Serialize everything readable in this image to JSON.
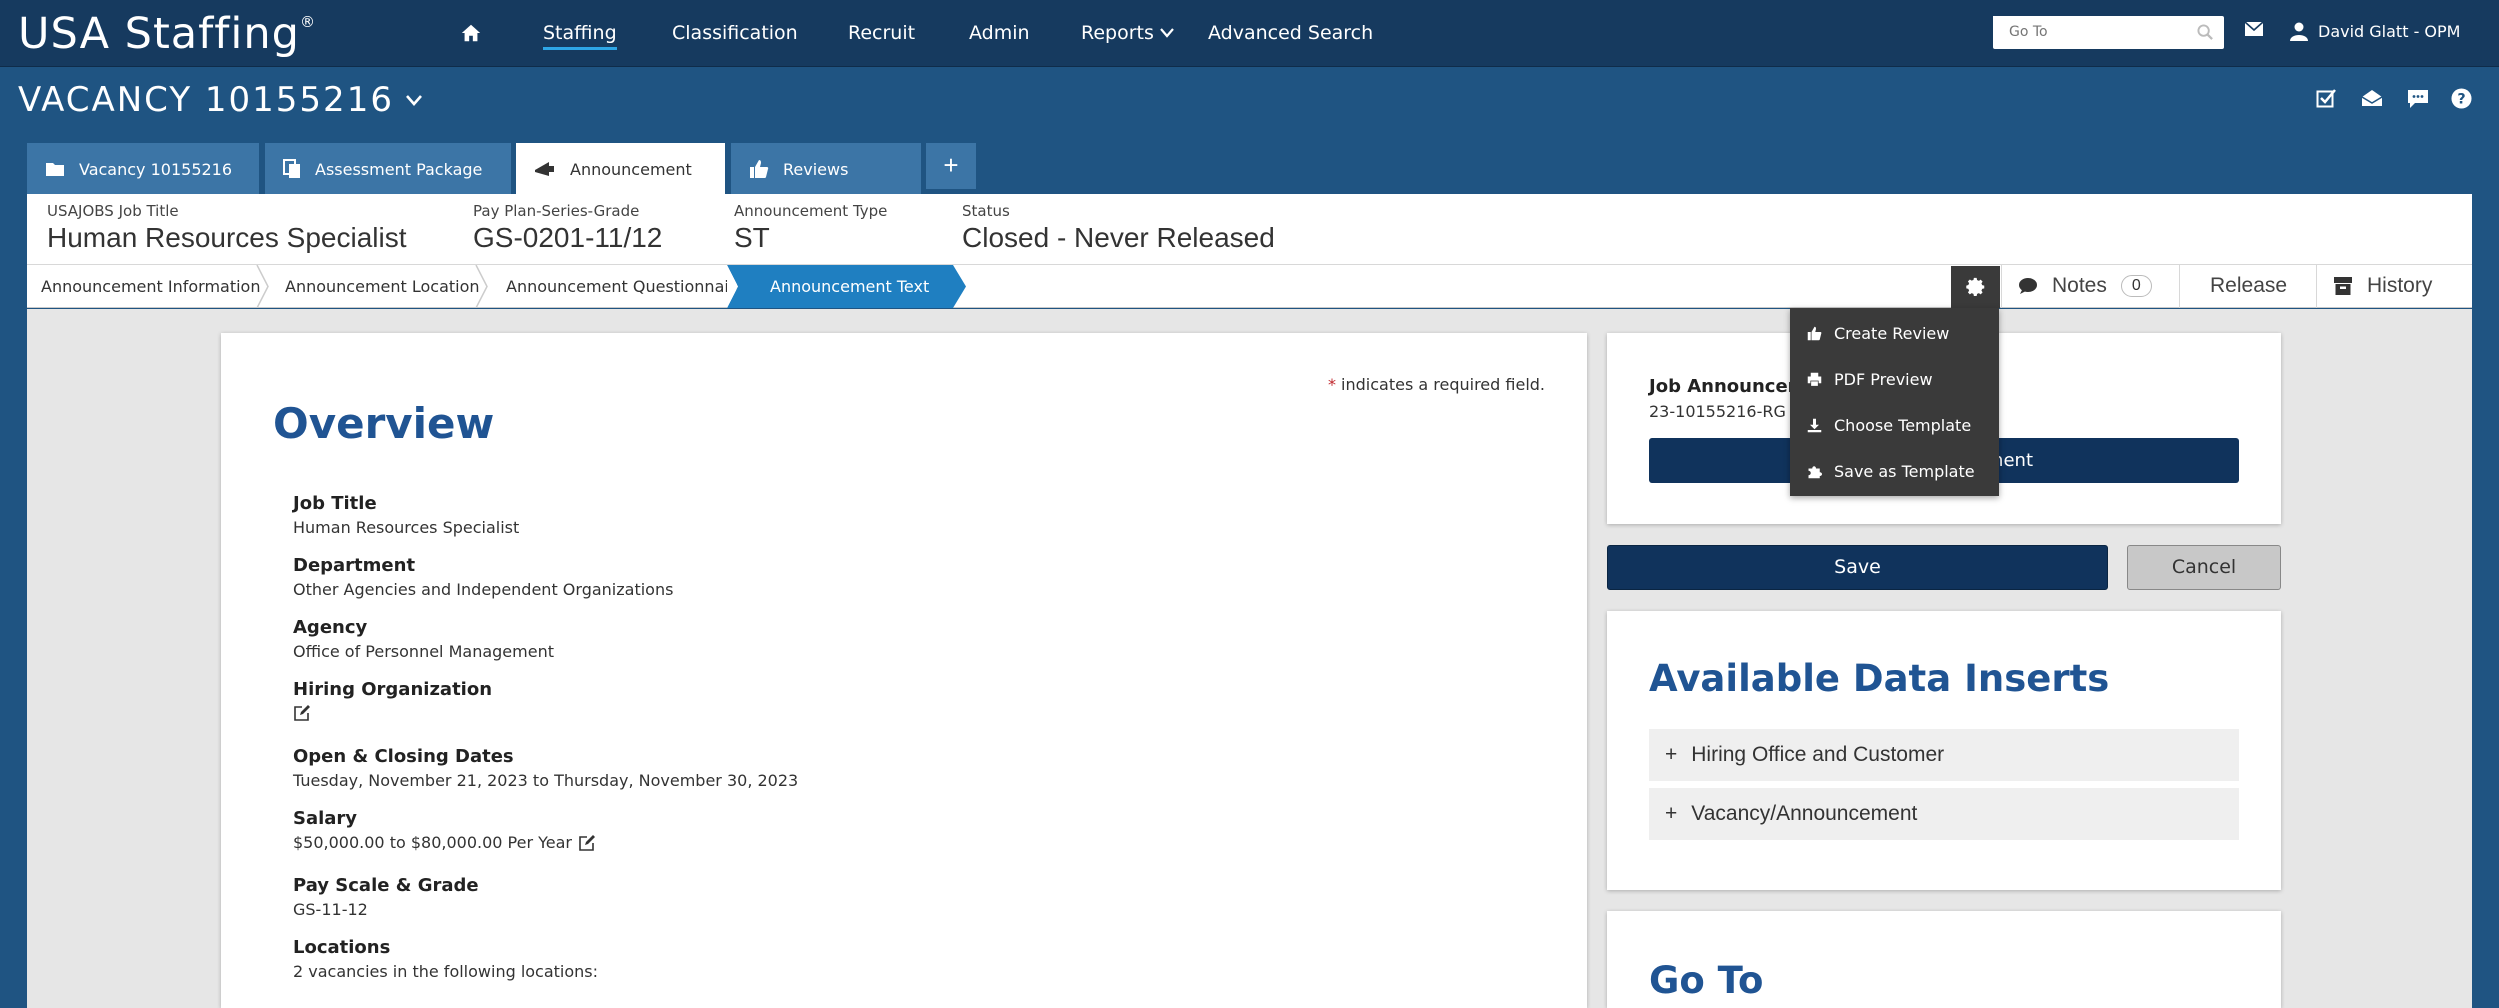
{
  "app": {
    "logo": "USA Staffing",
    "logo_mark": "®"
  },
  "nav": {
    "items": [
      {
        "label": "Staffing",
        "active": true
      },
      {
        "label": "Classification"
      },
      {
        "label": "Recruit"
      },
      {
        "label": "Admin"
      },
      {
        "label": "Reports"
      },
      {
        "label": "Advanced Search"
      }
    ],
    "goto_placeholder": "Go To",
    "user": "David Glatt - OPM"
  },
  "vacancy": {
    "title": "VACANCY 10155216"
  },
  "tabs": [
    {
      "label": "Vacancy 10155216",
      "icon": "folder-icon"
    },
    {
      "label": "Assessment Package",
      "icon": "documents-icon"
    },
    {
      "label": "Announcement",
      "icon": "megaphone-icon",
      "active": true
    },
    {
      "label": "Reviews",
      "icon": "thumbs-up-icon"
    }
  ],
  "info": {
    "job_title_label": "USAJOBS Job Title",
    "job_title": "Human Resources Specialist",
    "grade_label": "Pay Plan-Series-Grade",
    "grade": "GS-0201-11/12",
    "type_label": "Announcement Type",
    "type": "ST",
    "status_label": "Status",
    "status": "Closed - Never Released"
  },
  "breadcrumbs": [
    {
      "label": "Announcement Information"
    },
    {
      "label": "Announcement Location"
    },
    {
      "label": "Announcement Questionnaire"
    },
    {
      "label": "Announcement Text",
      "active": true
    }
  ],
  "actions": {
    "notes": "Notes",
    "notes_count": "0",
    "release": "Release",
    "history": "History"
  },
  "menu": {
    "items": [
      {
        "label": "Create Review",
        "icon": "thumbs-up-icon"
      },
      {
        "label": "PDF Preview",
        "icon": "printer-icon"
      },
      {
        "label": "Choose Template",
        "icon": "download-icon"
      },
      {
        "label": "Save as Template",
        "icon": "puzzle-icon"
      }
    ]
  },
  "overview": {
    "required_note": "indicates a required field.",
    "required_star": "*",
    "title": "Overview",
    "fields": [
      {
        "label": "Job Title",
        "value": "Human Resources Specialist"
      },
      {
        "label": "Department",
        "value": "Other Agencies and Independent Organizations"
      },
      {
        "label": "Agency",
        "value": "Office of Personnel Management"
      },
      {
        "label": "Hiring Organization",
        "value": ""
      },
      {
        "label": "Open & Closing Dates",
        "value": "Tuesday, November 21, 2023 to Thursday, November 30, 2023"
      },
      {
        "label": "Salary",
        "value": "$50,000.00 to $80,000.00 Per Year"
      },
      {
        "label": "Pay Scale & Grade",
        "value": "GS-11-12"
      },
      {
        "label": "Locations",
        "value": "2 vacancies in the following locations:"
      }
    ]
  },
  "sidebar": {
    "job_announcement_label": "Job Announcem",
    "job_announcement_value": "23-10155216-RG",
    "job_announcement_button": "ment",
    "save": "Save",
    "cancel": "Cancel",
    "data_inserts_title": "Available Data Inserts",
    "data_inserts": [
      {
        "label": "Hiring Office and Customer"
      },
      {
        "label": "Vacancy/Announcement"
      }
    ],
    "goto_title": "Go To"
  }
}
